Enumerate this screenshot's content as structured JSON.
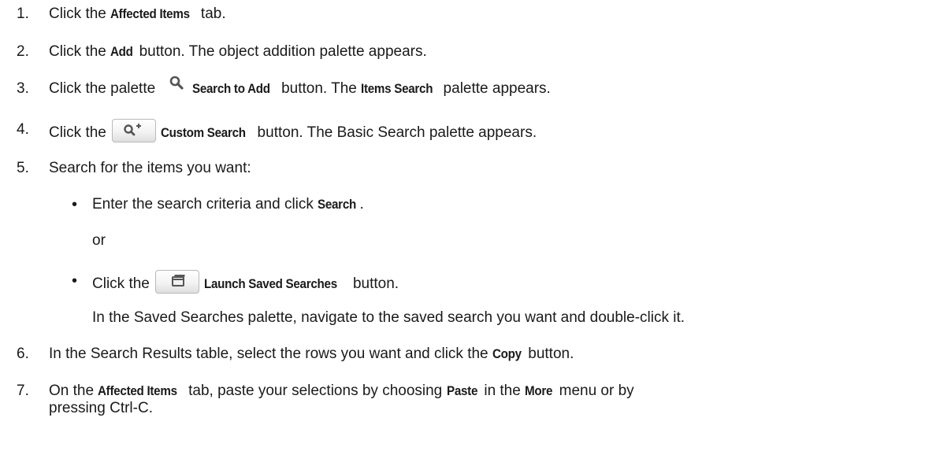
{
  "steps": [
    {
      "num": "1.",
      "parts": [
        "Click the ",
        "Affected Items",
        " tab."
      ]
    },
    {
      "num": "2.",
      "parts": [
        "Click the ",
        "Add",
        " button. The object addition palette appears."
      ]
    },
    {
      "num": "3.",
      "parts": [
        "Click the palette ",
        "Search to Add",
        " button. The ",
        "Items Search",
        " palette appears."
      ]
    },
    {
      "num": "4.",
      "parts": [
        "Click the ",
        "Custom Search",
        " button. The Basic Search palette appears."
      ]
    },
    {
      "num": "5.",
      "parts": [
        "Search for the items you want:"
      ]
    },
    {
      "num": "6.",
      "parts": [
        "In the Search Results table, select the rows you want and click the ",
        "Copy",
        " button."
      ]
    },
    {
      "num": "7.",
      "parts": [
        "On the ",
        "Affected Items",
        " tab, paste your selections by choosing ",
        "Paste",
        " in the ",
        "More",
        " menu or by"
      ],
      "cont": "pressing Ctrl-C."
    }
  ],
  "sub_steps": [
    {
      "bullet": "•",
      "parts": [
        "Enter the search criteria and click ",
        "Search",
        "."
      ]
    },
    {
      "or": "or"
    },
    {
      "bullet": "•",
      "parts": [
        "Click the ",
        "Launch Saved Searches",
        " button."
      ]
    },
    {
      "note": "In the Saved Searches palette, navigate to the saved search you want and double-click it."
    }
  ],
  "icons": {
    "search_to_add": "magnifier-icon",
    "custom_search": "magnifier-plus-icon",
    "saved_searches": "folder-window-icon"
  },
  "colors": {
    "text": "#1a1a1a",
    "icon": "#555555",
    "button_border": "#b9b9b9"
  }
}
